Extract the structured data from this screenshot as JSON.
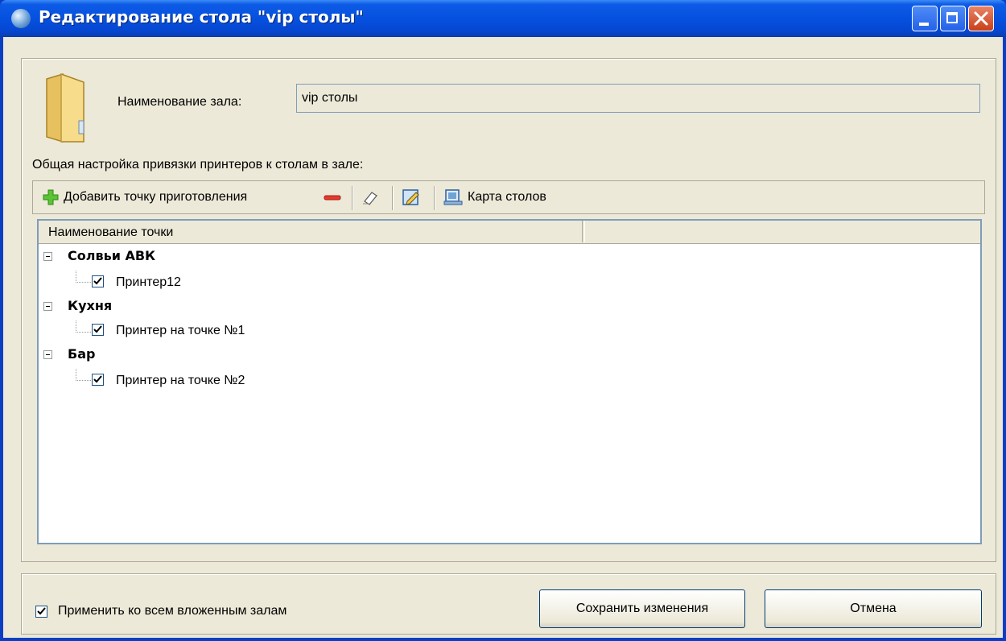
{
  "window": {
    "title": "Редактирование стола \"vip столы\"",
    "icons": {
      "app": "globe-icon",
      "minimize": "minimize-icon",
      "maximize": "maximize-icon",
      "close": "close-icon"
    }
  },
  "hall": {
    "label": "Наименование зала:",
    "value": "vip столы",
    "icon": "folder-icon"
  },
  "section_label": "Общая настройка привязки принтеров к столам в зале:",
  "toolbar": {
    "add_label": "Добавить точку приготовления",
    "map_label": "Карта столов",
    "icons": [
      "plus-icon",
      "minus-icon",
      "eraser-icon",
      "edit-icon",
      "table-map-icon"
    ]
  },
  "tree": {
    "columns": [
      "Наименование точки",
      ""
    ],
    "groups": [
      {
        "name": "Солвьи АВК",
        "expanded": true,
        "items": [
          {
            "label": "Принтер12",
            "checked": true
          }
        ]
      },
      {
        "name": "Кухня",
        "expanded": true,
        "items": [
          {
            "label": "Принтер на точке №1",
            "checked": true
          }
        ]
      },
      {
        "name": "Бар",
        "expanded": true,
        "items": [
          {
            "label": "Принтер на точке №2",
            "checked": true
          }
        ]
      }
    ]
  },
  "footer": {
    "apply_label": "Применить ко всем вложенным залам",
    "apply_checked": true,
    "save_label": "Сохранить изменения",
    "cancel_label": "Отмена"
  },
  "colors": {
    "titlebar": "#0651e0",
    "dialog_bg": "#ece9d8",
    "close_button": "#c9401a"
  }
}
